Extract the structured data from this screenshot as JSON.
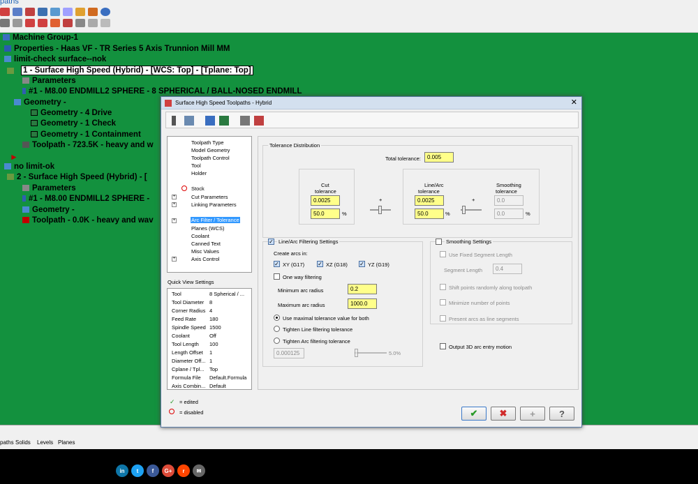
{
  "app": {
    "title": "paths"
  },
  "tree": {
    "machine_group": "Machine Group-1",
    "properties": "Properties - Haas VF - TR Series 5 Axis Trunnion Mill MM",
    "group1": "limit-check surface--nok",
    "op1": "1 - Surface High Speed (Hybrid) - [WCS: Top] - [Tplane: Top]",
    "op1_params": "Parameters",
    "op1_tool": "#1 - M8.00 ENDMILL2 SPHERE - 8 SPHERICAL / BALL-NOSED ENDMILL",
    "op1_geom": "Geometry -",
    "geom_drive": "Geometry - 4 Drive",
    "geom_check": "Geometry - 1 Check",
    "geom_containment": "Geometry - 1 Containment",
    "op1_toolpath": "Toolpath - 723.5K - heavy and w",
    "group2": "no limit-ok",
    "op2": "2 - Surface High Speed (Hybrid) - [",
    "op2_params": "Parameters",
    "op2_tool": "#1 - M8.00 ENDMILL2 SPHERE -",
    "op2_geom": "Geometry -",
    "op2_toolpath": "Toolpath - 0.0K - heavy and wav"
  },
  "bottom_tabs": [
    "paths",
    "Solids",
    "Levels",
    "Planes"
  ],
  "social": [
    {
      "label": "in",
      "color": "#0e76a8"
    },
    {
      "label": "t",
      "color": "#1da1f2"
    },
    {
      "label": "f",
      "color": "#3b5998"
    },
    {
      "label": "G+",
      "color": "#dd4b39"
    },
    {
      "label": "r",
      "color": "#ff4500"
    },
    {
      "label": "✉",
      "color": "#666666"
    }
  ],
  "dialog": {
    "title": "Surface High Speed Toolpaths - Hybrid",
    "nav": {
      "toolpath_type": "Toolpath Type",
      "model_geometry": "Model Geometry",
      "toolpath_control": "Toolpath Control",
      "tool": "Tool",
      "holder": "Holder",
      "stock": "Stock",
      "cut_parameters": "Cut Parameters",
      "linking_parameters": "Linking Parameters",
      "arc_filter": "Arc Filter / Tolerance",
      "planes": "Planes (WCS)",
      "coolant": "Coolant",
      "canned_text": "Canned Text",
      "misc_values": "Misc Values",
      "axis_control": "Axis Control"
    },
    "quick_view": {
      "label": "Quick View Settings",
      "rows": [
        {
          "k": "Tool",
          "v": "8 Spherical / ..."
        },
        {
          "k": "Tool Diameter",
          "v": "8"
        },
        {
          "k": "Corner Radius",
          "v": "4"
        },
        {
          "k": "Feed Rate",
          "v": "180"
        },
        {
          "k": "Spindle Speed",
          "v": "1500"
        },
        {
          "k": "Coolant",
          "v": "Off"
        },
        {
          "k": "Tool Length",
          "v": "100"
        },
        {
          "k": "Length Offset",
          "v": "1"
        },
        {
          "k": "Diameter Off...",
          "v": "1"
        },
        {
          "k": "Cplane / Tpl...",
          "v": "Top"
        },
        {
          "k": "Formula File",
          "v": "Default.Formula"
        },
        {
          "k": "Axis Combin...",
          "v": "Default"
        }
      ]
    },
    "legend": {
      "edited": "= edited",
      "disabled": "= disabled"
    },
    "tolerance": {
      "group_label": "Tolerance Distribution",
      "total_label": "Total tolerance:",
      "total_value": "0.005",
      "cut_label1": "Cut",
      "cut_label2": "tolerance",
      "cut_value": "0.0025",
      "cut_pct": "50.0",
      "linearc_label1": "Line/Arc",
      "linearc_label2": "tolerance",
      "linearc_value": "0.0025",
      "linearc_pct": "50.0",
      "smoothing_label1": "Smoothing",
      "smoothing_label2": "tolerance",
      "smoothing_value": "0.0",
      "smoothing_pct": "0.0",
      "pct_sign": "%",
      "plus": "+"
    },
    "filter": {
      "label": "Line/Arc Filtering Settings",
      "create_arcs": "Create arcs in:",
      "xy": "XY (G17)",
      "xz": "XZ (G18)",
      "yz": "YZ (G19)",
      "one_way": "One way filtering",
      "min_radius_label": "Minimum arc radius",
      "min_radius": "0.2",
      "max_radius_label": "Maximum arc radius",
      "max_radius": "1000.0",
      "opt_max": "Use maximal tolerance value for both",
      "opt_line": "Tighten Line filtering tolerance",
      "opt_arc": "Tighten Arc filtering tolerance",
      "tight_value": "0.000125",
      "tight_pct": "5.0%"
    },
    "smoothing": {
      "label": "Smoothing Settings",
      "fixed_seg": "Use Fixed Segment Length",
      "seg_len_label": "Segment Length",
      "seg_len": "0.4",
      "shift": "Shift points randomly along toolpath",
      "minimize": "Minimize number of points",
      "present_arcs": "Present arcs as line segments"
    },
    "output_3d": "Output 3D arc entry motion",
    "buttons": {
      "ok": "✔",
      "cancel": "✖",
      "add": "+",
      "help": "?"
    }
  }
}
